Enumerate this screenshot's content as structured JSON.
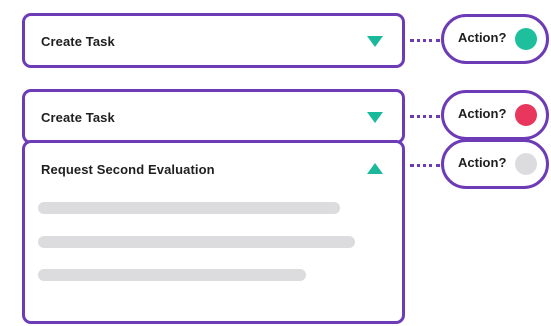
{
  "rows": [
    {
      "title": "Create Task",
      "expanded": false,
      "action_label": "Action?",
      "status_color": "#1dbf9c",
      "status": "green"
    },
    {
      "title": "Create Task",
      "expanded": false,
      "action_label": "Action?",
      "status_color": "#e8365c",
      "status": "red"
    },
    {
      "title": "Request Second Evaluation",
      "expanded": true,
      "action_label": "Action?",
      "status_color": "#dcdcdf",
      "status": "gray",
      "placeholder_lines": 3
    }
  ],
  "colors": {
    "accent": "#6d3bb5",
    "arrow": "#1ab99c",
    "skeleton": "#dcdcdf"
  },
  "icons": [
    "dropdown-arrow-down-icon",
    "dropdown-arrow-up-icon",
    "status-dot-icon"
  ]
}
